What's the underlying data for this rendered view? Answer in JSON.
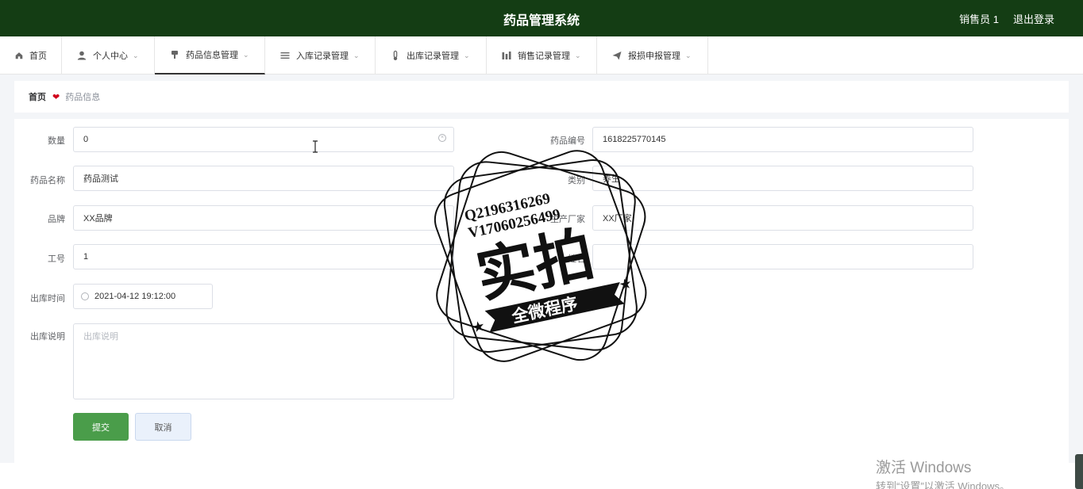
{
  "header": {
    "title": "药品管理系统",
    "user": "销售员 1",
    "logout": "退出登录"
  },
  "nav": {
    "items": [
      {
        "label": "首页",
        "icon": "home-icon"
      },
      {
        "label": "个人中心",
        "icon": "user-icon"
      },
      {
        "label": "药品信息管理",
        "icon": "medicine-icon"
      },
      {
        "label": "入库记录管理",
        "icon": "list-icon"
      },
      {
        "label": "出库记录管理",
        "icon": "thermometer-icon"
      },
      {
        "label": "销售记录管理",
        "icon": "chart-icon"
      },
      {
        "label": "报损申报管理",
        "icon": "send-icon"
      }
    ],
    "active_index": 2
  },
  "breadcrumb": {
    "home": "首页",
    "separator": "❤",
    "current": "药品信息"
  },
  "form": {
    "quantity_label": "数量",
    "quantity_value": "0",
    "drug_name_label": "药品名称",
    "drug_name_value": "药品测试",
    "brand_label": "品牌",
    "brand_value": "XX品牌",
    "employee_no_label": "工号",
    "employee_no_value": "1",
    "out_time_label": "出库时间",
    "out_time_value": "2021-04-12 19:12:00",
    "description_label": "出库说明",
    "description_placeholder": "出库说明",
    "drug_code_label": "药品编号",
    "drug_code_value": "1618225770145",
    "category_label": "类别",
    "category_value": "养生",
    "manufacturer_label": "生产厂家",
    "manufacturer_value": "XX厂家",
    "right_row4_label": "姓名",
    "right_row4_value": "",
    "submit": "提交",
    "cancel": "取消"
  },
  "watermark": {
    "line1": "Q2196316269",
    "line2": "V17060256499",
    "big": "实拍",
    "banner": "全微程序"
  },
  "windows_activation": {
    "line1": "激活 Windows",
    "line2": "转到“设置”以激活 Windows。"
  },
  "colors": {
    "header_bg": "#143d14",
    "primary_button": "#4a9d4a",
    "breadcrumb_heart": "#d0021b"
  }
}
